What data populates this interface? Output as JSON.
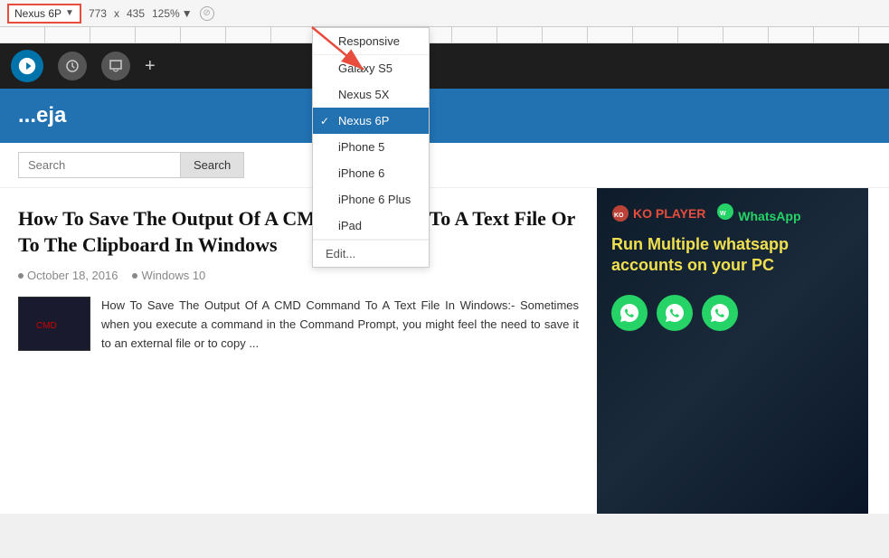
{
  "toolbar": {
    "device_label": "Nexus 6P",
    "width": "773",
    "x_label": "x",
    "height": "435",
    "zoom": "125%",
    "zoom_arrow": "▼"
  },
  "dropdown": {
    "items": [
      {
        "id": "responsive",
        "label": "Responsive",
        "selected": false
      },
      {
        "id": "galaxy-s5",
        "label": "Galaxy S5",
        "selected": false
      },
      {
        "id": "nexus-5x",
        "label": "Nexus 5X",
        "selected": false
      },
      {
        "id": "nexus-6p",
        "label": "Nexus 6P",
        "selected": true
      },
      {
        "id": "iphone-5",
        "label": "iPhone 5",
        "selected": false
      },
      {
        "id": "iphone-6",
        "label": "iPhone 6",
        "selected": false
      },
      {
        "id": "iphone-6-plus",
        "label": "iPhone 6 Plus",
        "selected": false
      },
      {
        "id": "ipad",
        "label": "iPad",
        "selected": false
      }
    ],
    "edit_label": "Edit..."
  },
  "admin_bar": {
    "icons": [
      "wordpress",
      "dashboard",
      "comment",
      "plus"
    ]
  },
  "site": {
    "title": "...eja",
    "search_placeholder": "Search",
    "search_button": "Search"
  },
  "article": {
    "title": "How To Save The Output Of A CMD Command To A Text File Or To The Clipboard In Windows",
    "date": "October 18, 2016",
    "category": "Windows 10",
    "excerpt": "How To Save The Output Of A CMD Command To A Text File In Windows:- Sometimes when you execute a command in the Command Prompt, you might feel the need to save it to an external file or to copy ..."
  },
  "ad": {
    "ko_label": "KO PLAYER",
    "wa_label": "WhatsApp",
    "text": "Run Multiple whatsapp accounts on your PC"
  }
}
